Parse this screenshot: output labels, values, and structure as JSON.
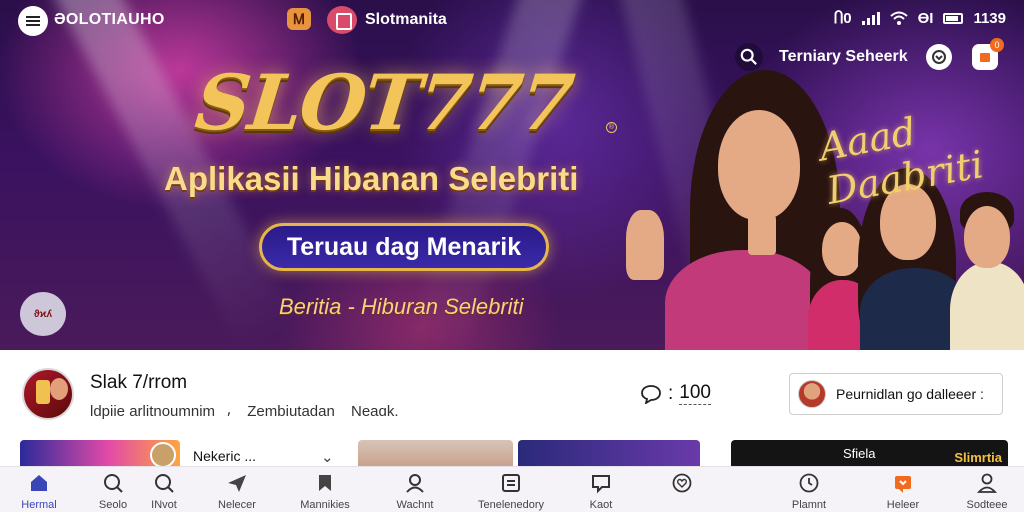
{
  "status_bar": {
    "brand_left": "ƏOLOTIAUHO",
    "brand_center": "Slotmanita",
    "tab_badge": "Ꮇ",
    "indicators": "Ⴖ0",
    "battery_glyph": "ꟷ",
    "time": "1139"
  },
  "search": {
    "placeholder": "Terniary Seheerk"
  },
  "notification_count": "0",
  "hero": {
    "title": "SLOT777",
    "subtitle": "Aplikasii Hibanan Selebriti",
    "pill_label": "Teruau dag Menarik",
    "tagline": "Beritia - Hiburan Selebriti",
    "script_text": "Aaad Daabriti",
    "badge_text": "ϑϰʎ"
  },
  "profile": {
    "name": "Slak 7/rrom",
    "meta": [
      "Ɩdpiie arlitnoumnim",
      "Zembiutadan",
      "Neaɑk."
    ],
    "meta_sep": "⸴",
    "count": "100",
    "follow_label": "Peurnidlan go dalleeer :"
  },
  "cards": {
    "card1_text": "Nekeric ..."
  },
  "card4": {
    "text1": "Sfiela",
    "text2": "Slimrtia"
  },
  "bottom_nav": [
    {
      "label": "Hermal",
      "icon": "home-icon",
      "active": true
    },
    {
      "label": "Seolo",
      "icon": "search-icon",
      "active": false
    },
    {
      "label": "INvot",
      "icon": "search-icon",
      "active": false
    },
    {
      "label": "Nelecer",
      "icon": "send-icon",
      "active": false
    },
    {
      "label": "Mannikies",
      "icon": "bookmark-icon",
      "active": false
    },
    {
      "label": "Wachnt",
      "icon": "person-icon",
      "active": false
    },
    {
      "label": "Tenelenedory",
      "icon": "document-icon",
      "active": false
    },
    {
      "label": "Kaot",
      "icon": "chat-icon",
      "active": false
    },
    {
      "label": "",
      "icon": "heart-icon",
      "active": false
    },
    {
      "label": "Plamnt",
      "icon": "clock-icon",
      "active": false
    },
    {
      "label": "Heleer",
      "icon": "message-icon",
      "active": false
    },
    {
      "label": "Sodteee",
      "icon": "profile-icon",
      "active": false
    }
  ],
  "colors": {
    "accent": "#3a46b8",
    "hero_gold": "#f3c45a",
    "notif_orange": "#f26a1b"
  }
}
